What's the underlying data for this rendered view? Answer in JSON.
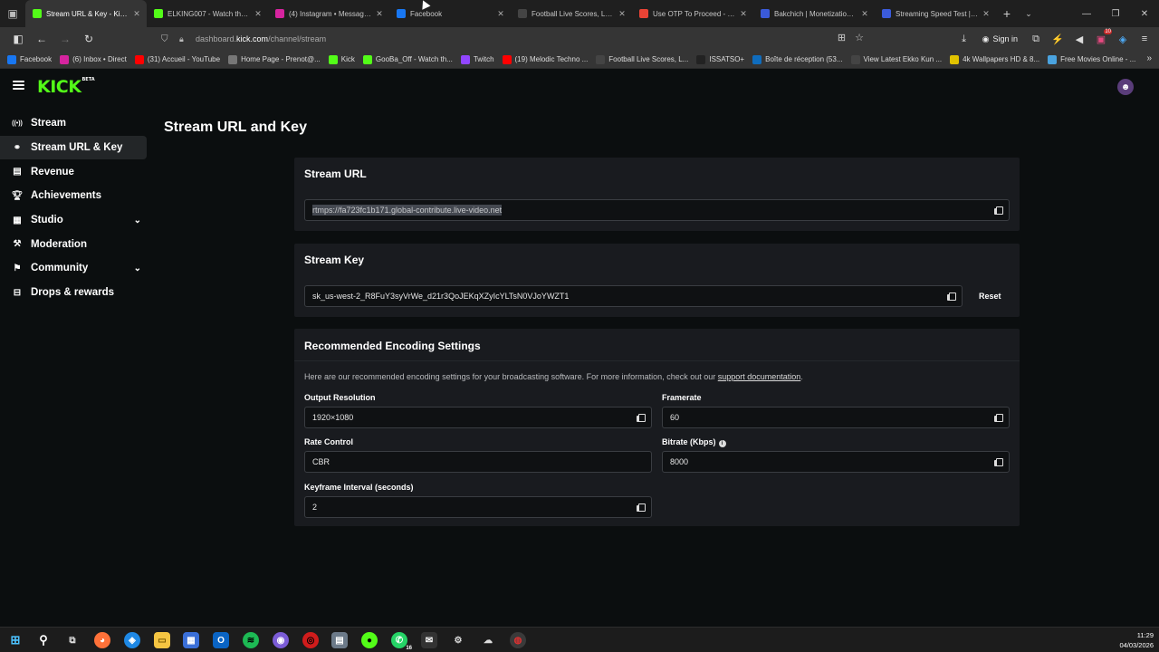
{
  "browser": {
    "tabs": [
      {
        "title": "Stream URL & Key - Kick D",
        "favicon": "kick-icon",
        "color": "#53fc18",
        "active": true
      },
      {
        "title": "ELKING007 - Watch the VO",
        "favicon": "kick-icon",
        "color": "#53fc18",
        "active": false
      },
      {
        "title": "(4) Instagram • Messages",
        "favicon": "instagram-icon",
        "color": "#d6249f",
        "active": false
      },
      {
        "title": "Facebook",
        "favicon": "facebook-icon",
        "color": "#1877f2",
        "active": false
      },
      {
        "title": "Football Live Scores, Latest",
        "favicon": "generic-icon",
        "color": "#444444",
        "active": false
      },
      {
        "title": "Use OTP To Proceed - azizh",
        "favicon": "gmail-icon",
        "color": "#ea4335",
        "active": false
      },
      {
        "title": "Bakchich | Monetization fo",
        "favicon": "bakchich-icon",
        "color": "#3a5ad9",
        "active": false
      },
      {
        "title": "Streaming Speed Test | High",
        "favicon": "speedtest-icon",
        "color": "#3b5bdb",
        "active": false
      }
    ],
    "url_prefix": "dashboard.",
    "url_host": "kick.com",
    "url_path": "/channel/stream",
    "sign_in_label": "Sign in",
    "notification_count": "10",
    "bookmarks": [
      {
        "label": "Facebook",
        "icon": "facebook-icon",
        "color": "#1877f2"
      },
      {
        "label": "(6) Inbox • Direct",
        "icon": "instagram-icon",
        "color": "#d6249f"
      },
      {
        "label": "(31) Accueil - YouTube",
        "icon": "youtube-icon",
        "color": "#ff0000"
      },
      {
        "label": "Home Page - Prenot@...",
        "icon": "document-icon",
        "color": "#777777"
      },
      {
        "label": "Kick",
        "icon": "kick-icon",
        "color": "#53fc18"
      },
      {
        "label": "GooBa_Off - Watch th...",
        "icon": "kick-icon",
        "color": "#53fc18"
      },
      {
        "label": "Twitch",
        "icon": "twitch-icon",
        "color": "#9146ff"
      },
      {
        "label": "(19) Melodic Techno ...",
        "icon": "youtube-icon",
        "color": "#ff0000"
      },
      {
        "label": "Football Live Scores, L...",
        "icon": "generic-icon",
        "color": "#444444"
      },
      {
        "label": "ISSATSO+",
        "icon": "a-icon",
        "color": "#222222"
      },
      {
        "label": "Boîte de réception (53...",
        "icon": "outlook-icon",
        "color": "#0f6cbd"
      },
      {
        "label": "View Latest Ekko Kun ...",
        "icon": "generic-icon",
        "color": "#444444"
      },
      {
        "label": "4k Wallpapers HD & 8...",
        "icon": "wallpaper-icon",
        "color": "#e0c200"
      },
      {
        "label": "Free Movies Online - ...",
        "icon": "globe-icon",
        "color": "#4aa3df"
      }
    ]
  },
  "app": {
    "logo_text": "KICK",
    "logo_badge": "BETA",
    "accent_color": "#53fc18"
  },
  "sidebar": {
    "items": [
      {
        "label": "Stream",
        "icon": "broadcast-icon",
        "active": false,
        "expandable": false
      },
      {
        "label": "Stream URL & Key",
        "icon": "link-icon",
        "active": true,
        "expandable": false
      },
      {
        "label": "Revenue",
        "icon": "revenue-icon",
        "active": false,
        "expandable": false
      },
      {
        "label": "Achievements",
        "icon": "trophy-icon",
        "active": false,
        "expandable": false
      },
      {
        "label": "Studio",
        "icon": "studio-icon",
        "active": false,
        "expandable": true
      },
      {
        "label": "Moderation",
        "icon": "moderation-icon",
        "active": false,
        "expandable": false
      },
      {
        "label": "Community",
        "icon": "community-icon",
        "active": false,
        "expandable": true
      },
      {
        "label": "Drops & rewards",
        "icon": "gift-icon",
        "active": false,
        "expandable": false
      }
    ]
  },
  "main": {
    "title": "Stream URL and Key",
    "stream_url": {
      "heading": "Stream URL",
      "value": "rtmps://fa723fc1b171.global-contribute.live-video.net"
    },
    "stream_key": {
      "heading": "Stream Key",
      "value": "sk_us-west-2_R8FuY3syVrWe_d21r3QoJEKqXZyIcYLTsN0VJoYWZT1",
      "reset_label": "Reset"
    },
    "encoding": {
      "heading": "Recommended Encoding Settings",
      "description": "Here are our recommended encoding settings for your broadcasting software. For more information, check out our",
      "link_text": "support documentation",
      "fields": {
        "output_resolution": {
          "label": "Output Resolution",
          "value": "1920×1080"
        },
        "framerate": {
          "label": "Framerate",
          "value": "60"
        },
        "rate_control": {
          "label": "Rate Control",
          "value": "CBR"
        },
        "bitrate": {
          "label": "Bitrate (Kbps)",
          "value": "8000"
        },
        "keyframe_interval": {
          "label": "Keyframe Interval (seconds)",
          "value": "2"
        }
      }
    }
  },
  "taskbar": {
    "time": "11:29",
    "date": "04/03/2026",
    "whatsapp_badge": "16"
  }
}
